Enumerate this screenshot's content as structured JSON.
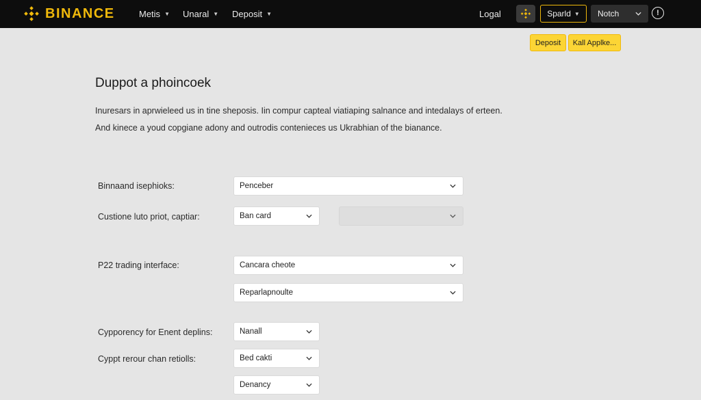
{
  "brand": {
    "name": "BINANCE",
    "color": "#f0b90b"
  },
  "nav": {
    "items": [
      {
        "label": "Metis"
      },
      {
        "label": "Unaral"
      },
      {
        "label": "Deposit"
      }
    ],
    "login": "Logal",
    "spot": "Sparld",
    "notch": "Notch",
    "info_icon": "info-icon",
    "icon_button": "binance-logo-icon"
  },
  "actions": {
    "deposit": "Deposit",
    "apply": "Kall Applke..."
  },
  "page": {
    "title": "Duppot a phoincoek",
    "para1": "Inuresars in aprwieleed us in tine sheposis. Iin compur capteal viatiaping salnance and intedalays of erteen.",
    "para2": "And kinece a youd copgiane adony and outrodis contenieces us Ukrabhian of the bianance."
  },
  "form": {
    "rows": [
      {
        "label": "Binnaand isephioks:",
        "select": "Penceber"
      },
      {
        "label": "Custione luto priot, captiar:",
        "select": "Ban card",
        "select2": ""
      },
      {
        "label": "P22 trading interface:",
        "select": "Cancara cheote",
        "select2": "Reparlapnoulte"
      },
      {
        "label": "Cypporency for Enent deplins:",
        "select": "Nanall"
      },
      {
        "label": "Cyppt rerour chan retiolls:",
        "select": "Bed cakti",
        "select2": "Denancy"
      }
    ]
  }
}
